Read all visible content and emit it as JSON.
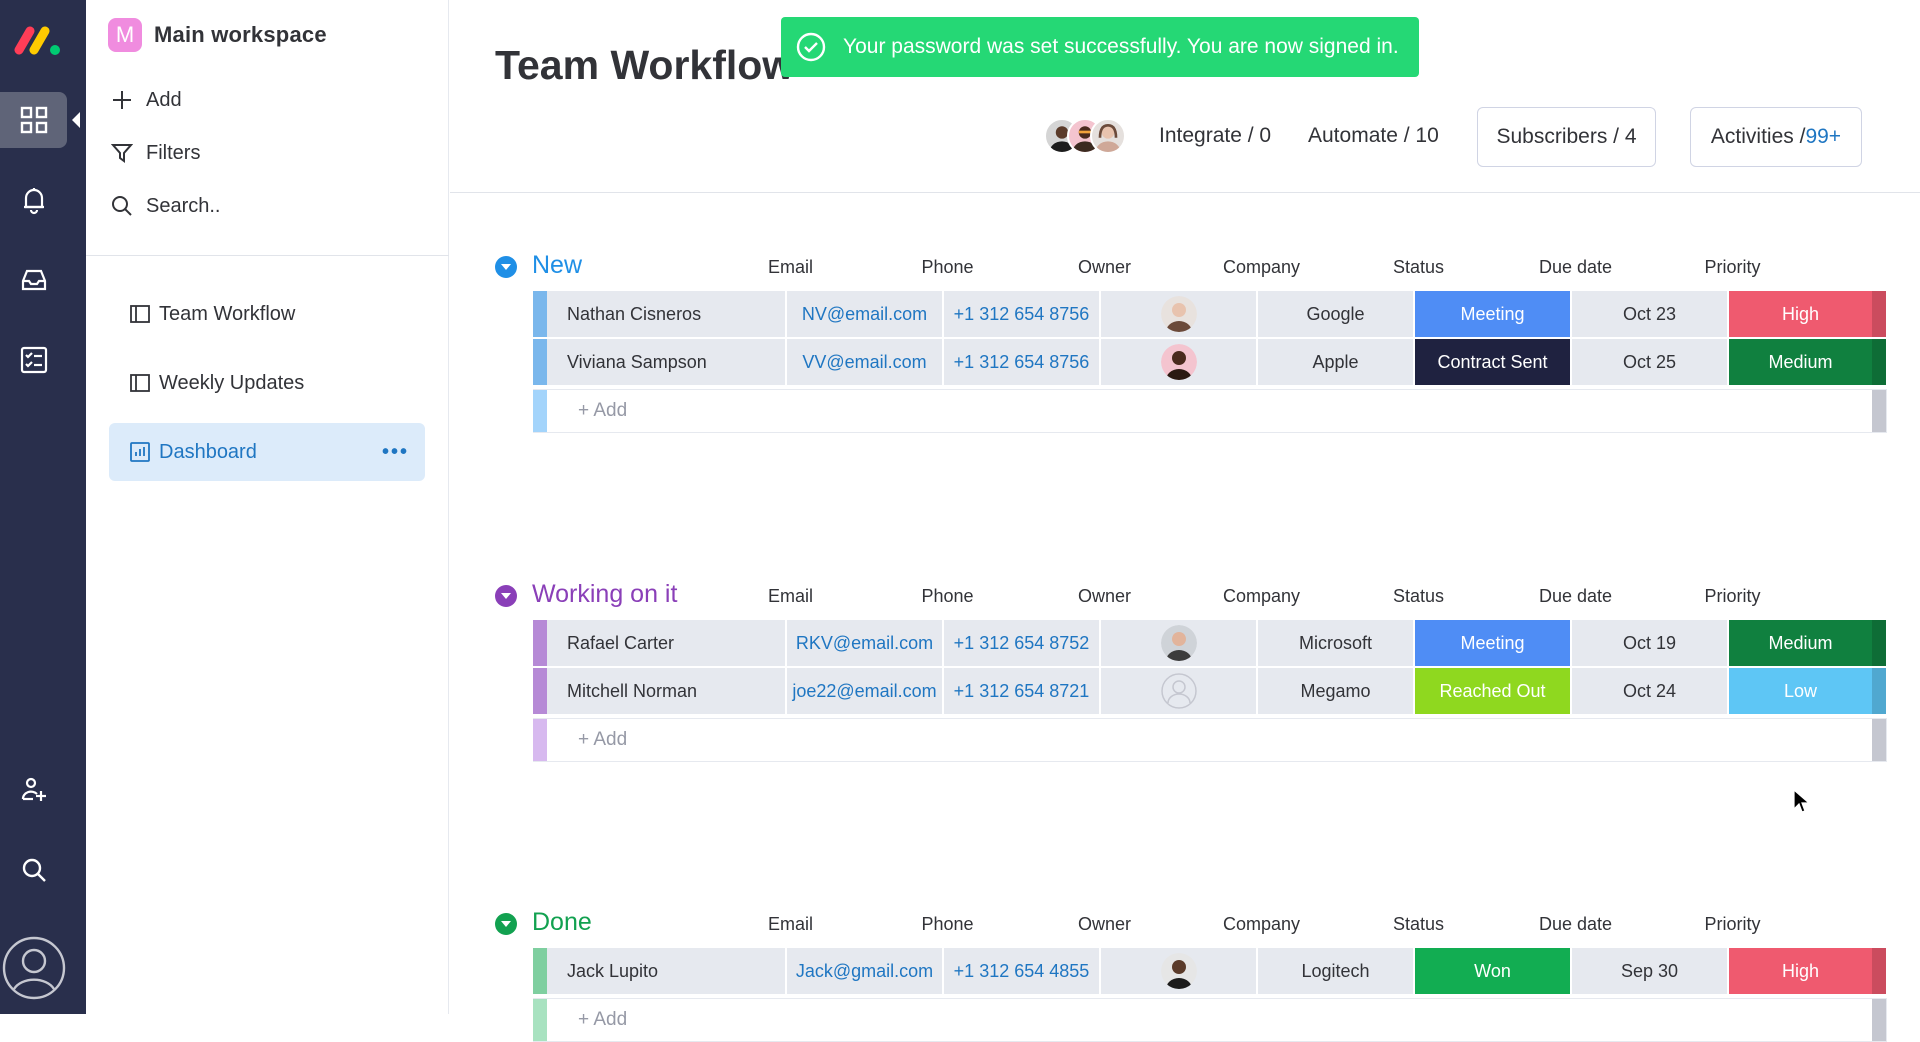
{
  "rail": {
    "icons": [
      "monday-logo",
      "workspaces-icon",
      "bell-icon",
      "inbox-icon",
      "my-work-icon",
      "invite-user-icon",
      "search-icon",
      "profile-icon"
    ]
  },
  "workspace": {
    "avatar_letter": "M",
    "title": "Main workspace",
    "actions": {
      "add": "Add",
      "filters": "Filters",
      "search": "Search.."
    },
    "items": [
      {
        "label": "Team Workflow",
        "icon": "board-icon"
      },
      {
        "label": "Weekly Updates",
        "icon": "board-icon"
      },
      {
        "label": "Dashboard",
        "icon": "dashboard-icon",
        "active": true,
        "more": "•••"
      }
    ]
  },
  "header": {
    "board_title": "Team Workflow",
    "integrate": "Integrate / 0",
    "automate": "Automate / 10",
    "subscribers": "Subscribers / 4",
    "activities_label": "Activities /",
    "activities_count": "99+"
  },
  "toast": {
    "message": "Your password was set successfully. You are now signed in.",
    "color": "#25d875"
  },
  "columns": [
    "Email",
    "Phone",
    "Owner",
    "Company",
    "Status",
    "Due date",
    "Priority"
  ],
  "add_row_label": "+ Add",
  "colors": {
    "Meeting": "#4f8df5",
    "Contract Sent": "#1f2240",
    "Reached Out": "#8fd81f",
    "Won": "#12ad52",
    "High": "#ef5a6f",
    "Medium": "#10803f",
    "Low": "#5ec6f5"
  },
  "groups": [
    {
      "name": "New",
      "color": "#1f8fe6",
      "strip": "#7ab7ec",
      "add_strip": "#a3d4fb",
      "rows": [
        {
          "name": "Nathan Cisneros",
          "email": "NV@email.com",
          "phone": "+1 312 654 8756",
          "owner": "woman-glasses-avatar",
          "company": "Google",
          "status": "Meeting",
          "due": "Oct 23",
          "priority": "High"
        },
        {
          "name": "Viviana Sampson",
          "email": "VV@email.com",
          "phone": "+1 312 654 8756",
          "owner": "man-sunglasses-avatar",
          "company": "Apple",
          "status": "Contract Sent",
          "due": "Oct 25",
          "priority": "Medium"
        }
      ]
    },
    {
      "name": "Working on it",
      "color": "#8a3fb8",
      "strip": "#b68ad6",
      "add_strip": "#d7b9ef",
      "rows": [
        {
          "name": "Rafael Carter",
          "email": "RKV@email.com",
          "phone": "+1 312 654 8752",
          "owner": "man-avatar",
          "company": "Microsoft",
          "status": "Meeting",
          "due": "Oct 19",
          "priority": "Medium"
        },
        {
          "name": "Mitchell Norman",
          "email": "joe22@email.com",
          "phone": "+1 312 654 8721",
          "owner": "empty-avatar",
          "company": "Megamo",
          "status": "Reached Out",
          "due": "Oct 24",
          "priority": "Low"
        }
      ]
    },
    {
      "name": "Done",
      "color": "#12a150",
      "strip": "#7fcfa0",
      "add_strip": "#a8e2c0",
      "rows": [
        {
          "name": "Jack Lupito",
          "email": "Jack@gmail.com",
          "phone": "+1 312 654 4855",
          "owner": "man-beard-avatar",
          "company": "Logitech",
          "status": "Won",
          "due": "Sep 30",
          "priority": "High"
        }
      ]
    }
  ]
}
